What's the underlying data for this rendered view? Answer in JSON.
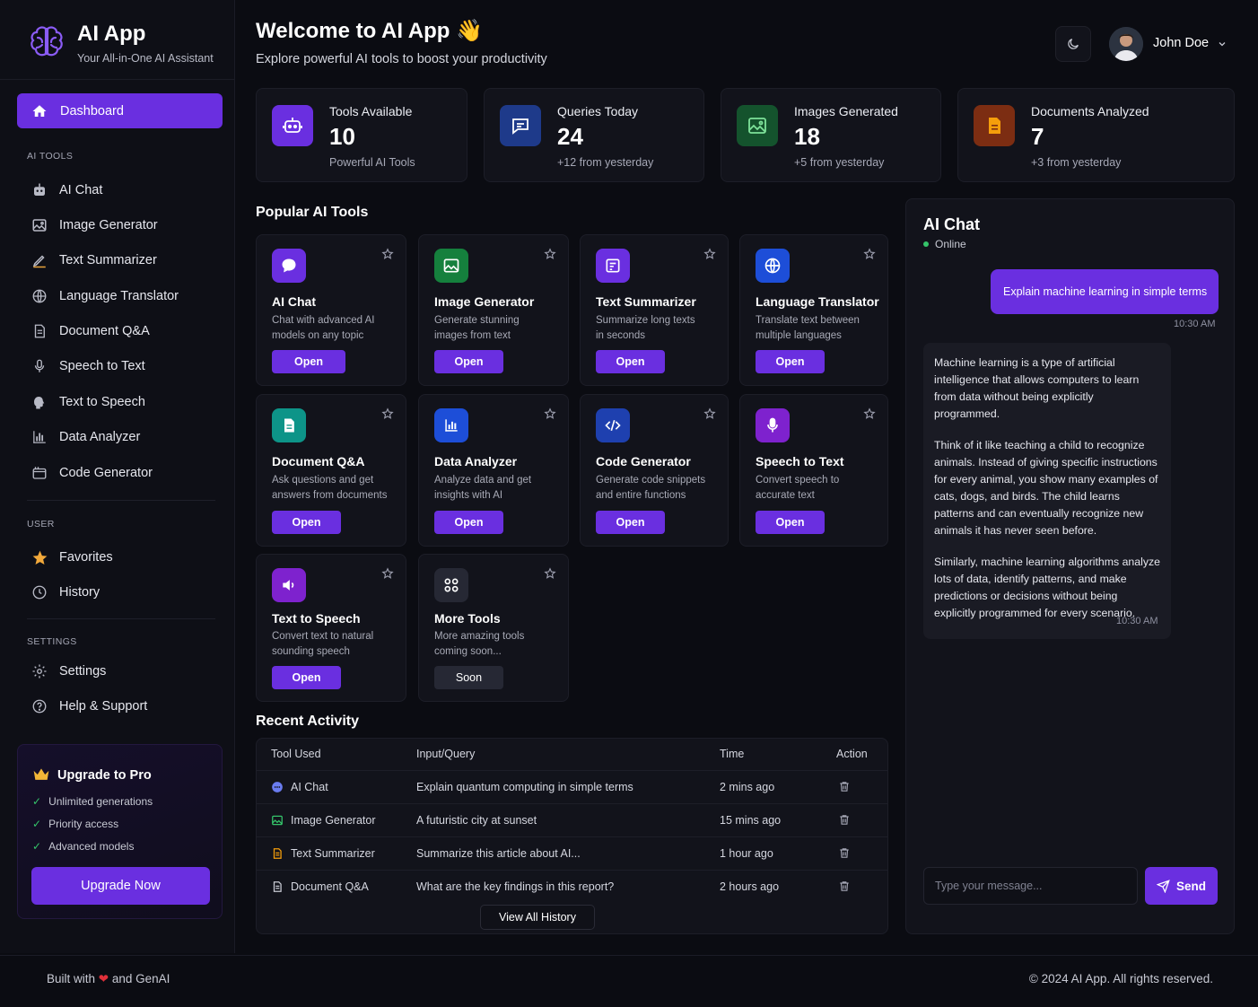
{
  "app": {
    "title": "AI App",
    "subtitle": "Your All-in-One AI Assistant"
  },
  "sidebar": {
    "active": {
      "label": "Dashboard",
      "icon": "home-icon"
    },
    "sections": {
      "ai_tools": "AI TOOLS",
      "user": "USER",
      "settings": "SETTINGS"
    },
    "ai_tools": [
      {
        "label": "AI Chat",
        "icon": "robot-icon"
      },
      {
        "label": "Image Generator",
        "icon": "image-icon"
      },
      {
        "label": "Text Summarizer",
        "icon": "pen-icon"
      },
      {
        "label": "Language Translator",
        "icon": "globe-icon"
      },
      {
        "label": "Document Q&A",
        "icon": "document-icon"
      },
      {
        "label": "Speech to Text",
        "icon": "microphone-icon"
      },
      {
        "label": "Text to Speech",
        "icon": "speaking-head-icon"
      },
      {
        "label": "Data Analyzer",
        "icon": "bar-chart-icon"
      },
      {
        "label": "Code Generator",
        "icon": "code-icon"
      }
    ],
    "user": [
      {
        "label": "Favorites",
        "icon": "star-icon"
      },
      {
        "label": "History",
        "icon": "clock-icon"
      }
    ],
    "settings": [
      {
        "label": "Settings",
        "icon": "gear-icon"
      },
      {
        "label": "Help & Support",
        "icon": "help-icon"
      }
    ],
    "upgrade": {
      "title": "Upgrade to Pro",
      "features": [
        "Unlimited generations",
        "Priority access",
        "Advanced models"
      ],
      "button": "Upgrade Now"
    }
  },
  "header": {
    "title": "Welcome to AI App",
    "wave": "👋",
    "subtitle": "Explore powerful AI tools to boost your productivity",
    "user_name": "John Doe"
  },
  "stats": [
    {
      "label": "Tools Available",
      "value": "10",
      "sub": "Powerful AI Tools",
      "color": "#6a2fe0"
    },
    {
      "label": "Queries Today",
      "value": "24",
      "sub": "+12 from yesterday",
      "color": "#1e3a8a"
    },
    {
      "label": "Images Generated",
      "value": "18",
      "sub": "+5 from yesterday",
      "color": "#14532d"
    },
    {
      "label": "Documents Analyzed",
      "value": "7",
      "sub": "+3 from yesterday",
      "color": "#7c2d12"
    }
  ],
  "popular": {
    "heading": "Popular AI Tools",
    "tools": [
      {
        "title": "AI Chat",
        "desc1": "Chat with advanced AI",
        "desc2": "models on any topic",
        "button": "Open"
      },
      {
        "title": "Image Generator",
        "desc1": "Generate stunning",
        "desc2": "images from text",
        "button": "Open"
      },
      {
        "title": "Text Summarizer",
        "desc1": "Summarize long texts",
        "desc2": "in seconds",
        "button": "Open"
      },
      {
        "title": "Language Translator",
        "desc1": "Translate text between",
        "desc2": "multiple languages",
        "button": "Open"
      },
      {
        "title": "Document Q&A",
        "desc1": "Ask questions and get",
        "desc2": "answers from documents",
        "button": "Open"
      },
      {
        "title": "Data Analyzer",
        "desc1": "Analyze data and get",
        "desc2": "insights with AI",
        "button": "Open"
      },
      {
        "title": "Code Generator",
        "desc1": "Generate code snippets",
        "desc2": "and entire functions",
        "button": "Open"
      },
      {
        "title": "Speech to Text",
        "desc1": "Convert speech to",
        "desc2": "accurate text",
        "button": "Open"
      },
      {
        "title": "Text to Speech",
        "desc1": "Convert text to natural",
        "desc2": "sounding speech",
        "button": "Open"
      },
      {
        "title": "More Tools",
        "desc1": "More amazing tools",
        "desc2": "coming soon...",
        "button": "Soon"
      }
    ]
  },
  "recent": {
    "heading": "Recent Activity",
    "columns": [
      "Tool Used",
      "Input/Query",
      "Time",
      "Action"
    ],
    "rows": [
      {
        "tool": "AI Chat",
        "query": "Explain quantum computing in simple terms",
        "time": "2 mins ago"
      },
      {
        "tool": "Image Generator",
        "query": "A futuristic city at sunset",
        "time": "15 mins ago"
      },
      {
        "tool": "Text Summarizer",
        "query": "Summarize this article about AI...",
        "time": "1 hour ago"
      },
      {
        "tool": "Document Q&A",
        "query": "What are the key findings in this report?",
        "time": "2 hours ago"
      }
    ],
    "view_all": "View All History"
  },
  "chat": {
    "title": "AI Chat",
    "status": "Online",
    "user_message": "Explain machine learning in simple terms",
    "user_time": "10:30 AM",
    "ai_paragraphs": [
      "Machine learning is a type of artificial intelligence that allows computers to learn from data without being explicitly programmed.",
      "Think of it like teaching a child to recognize animals. Instead of giving specific instructions for every animal, you show many examples of cats, dogs, and birds. The child learns patterns and can eventually recognize new animals it has never seen before.",
      "Similarly, machine learning algorithms analyze lots of data, identify patterns, and make predictions or decisions without being explicitly programmed for every scenario."
    ],
    "ai_time": "10:30 AM",
    "input_placeholder": "Type your message...",
    "send": "Send"
  },
  "footer": {
    "built_prefix": "Built with",
    "heart": "❤",
    "built_suffix": "and GenAI",
    "copyright": "© 2024 AI App. All rights reserved."
  },
  "colors": {
    "accent": "#6a2fe0",
    "background": "#0b0c12",
    "panel": "#12131b",
    "online": "#35c46a"
  }
}
